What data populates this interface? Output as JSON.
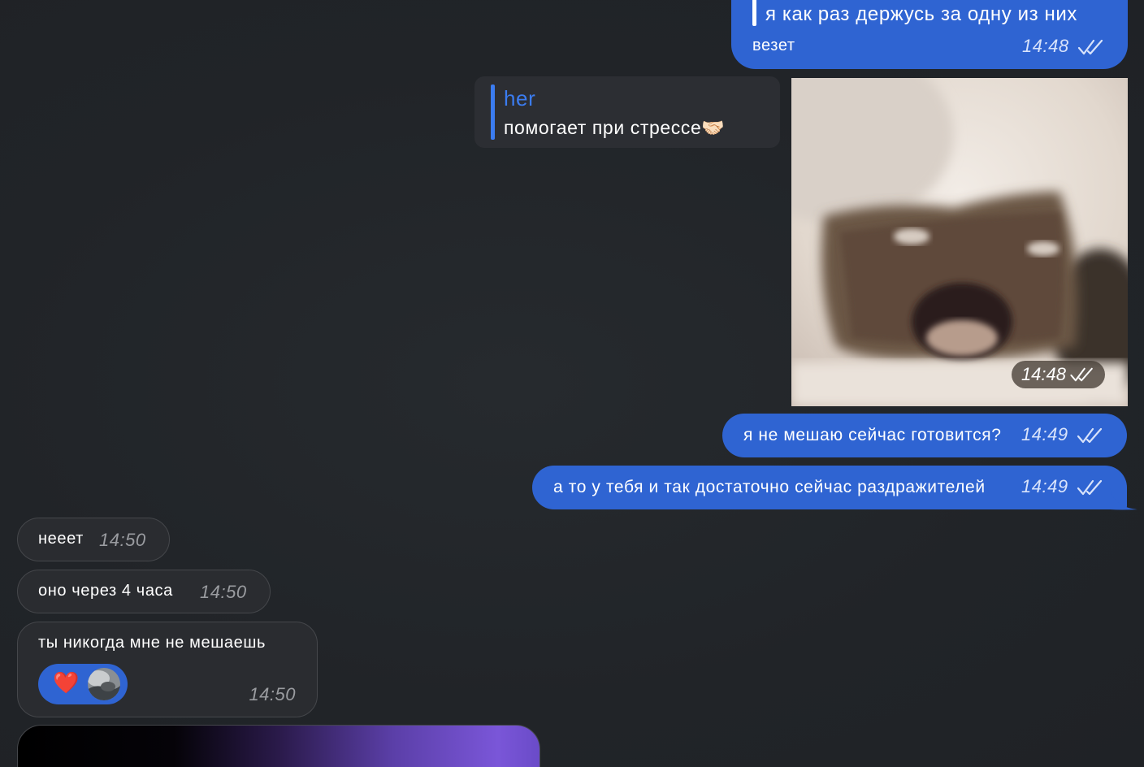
{
  "messages": {
    "m1": {
      "quote_text": "я как раз держусь за одну из них",
      "text": "везет",
      "time": "14:48",
      "status_icon": "double-check-icon"
    },
    "m2": {
      "quote_author": "her",
      "text": "помогает при стрессе",
      "emoji": "🤝🏻"
    },
    "photo": {
      "time": "14:48",
      "status_icon": "double-check-icon"
    },
    "m3": {
      "text": "я не мешаю сейчас готовится?",
      "time": "14:49",
      "status_icon": "double-check-icon"
    },
    "m4": {
      "text": "а то у тебя и так достаточно сейчас раздражителей",
      "time": "14:49",
      "status_icon": "double-check-icon"
    },
    "m5": {
      "text": "нееет",
      "time": "14:50"
    },
    "m6": {
      "text": "оно через 4 часа",
      "time": "14:50"
    },
    "m7": {
      "text": "ты никогда мне не мешаешь",
      "time": "14:50",
      "reaction_emoji": "❤️"
    }
  },
  "colors": {
    "outgoing_bubble": "#2f64d2",
    "incoming_bubble": "#2a2c30",
    "background": "#212428",
    "quote_accent": "#3b7cf0"
  }
}
